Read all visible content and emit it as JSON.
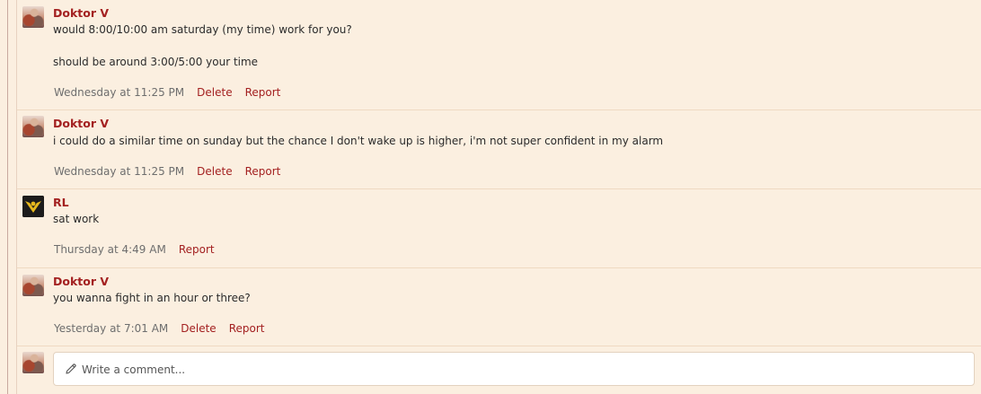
{
  "comments": [
    {
      "author": "Doktor V",
      "lines": [
        "would 8:00/10:00 am saturday (my time) work for you?",
        "should be around 3:00/5:00 your time"
      ],
      "time": "Wednesday at 11:25 PM",
      "actions": [
        "Delete",
        "Report"
      ]
    },
    {
      "author": "Doktor V",
      "lines": [
        "i could do a similar time on sunday but the chance I don't wake up is higher, i'm not super confident in my alarm"
      ],
      "time": "Wednesday at 11:25 PM",
      "actions": [
        "Delete",
        "Report"
      ]
    },
    {
      "author": "RL",
      "lines": [
        "sat work"
      ],
      "time": "Thursday at 4:49 AM",
      "actions": [
        "Report"
      ]
    },
    {
      "author": "Doktor V",
      "lines": [
        "you wanna fight in an hour or three?"
      ],
      "time": "Yesterday at 7:01 AM",
      "actions": [
        "Delete",
        "Report"
      ]
    }
  ],
  "composer": {
    "placeholder": "Write a comment..."
  },
  "icons": {
    "composer_icon": "pencil-icon",
    "rl_avatar_icon": "emblem-icon"
  },
  "colors": {
    "background": "#fbefe0",
    "author": "#a32020",
    "action": "#a32020"
  }
}
